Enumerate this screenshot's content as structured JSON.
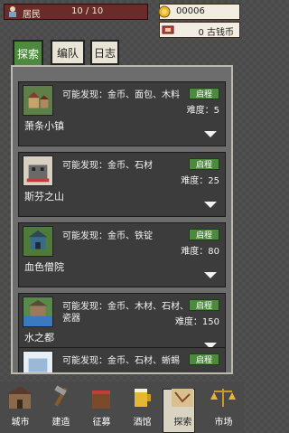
{
  "header": {
    "resident_label": "居民",
    "resident_count": "10 / 10",
    "gold": "00006",
    "coins": "0 古钱币"
  },
  "tabs": [
    {
      "label": "探索",
      "active": true
    },
    {
      "label": "编队",
      "active": false
    },
    {
      "label": "日志",
      "active": false
    }
  ],
  "locations": [
    {
      "name": "萧条小镇",
      "finds": "可能发现：金币、面包、木料",
      "go": "启程",
      "difficulty": "难度：5",
      "icon": "town-icon"
    },
    {
      "name": "斯芬之山",
      "finds": "可能发现：金币、石材",
      "go": "启程",
      "difficulty": "难度：25",
      "icon": "mountain-icon"
    },
    {
      "name": "血色僧院",
      "finds": "可能发现：金币、铁锭",
      "go": "启程",
      "difficulty": "难度：80",
      "icon": "monastery-icon"
    },
    {
      "name": "水之都",
      "finds": "可能发现：金币、木材、石材、瓷器",
      "go": "启程",
      "difficulty": "难度：150",
      "icon": "water-city-icon"
    },
    {
      "name": "",
      "finds": "可能发现：金币、石材、蜥蜴",
      "go": "启程",
      "difficulty": "",
      "icon": "ice-icon"
    }
  ],
  "nav": [
    {
      "label": "城市",
      "icon": "city-icon"
    },
    {
      "label": "建造",
      "icon": "build-icon"
    },
    {
      "label": "征募",
      "icon": "recruit-icon"
    },
    {
      "label": "酒馆",
      "icon": "tavern-icon"
    },
    {
      "label": "探索",
      "icon": "explore-icon",
      "active": true
    },
    {
      "label": "市场",
      "icon": "market-icon"
    }
  ],
  "colors": {
    "accent_green": "#4d8a3e",
    "resident_bg": "#6a2b2b",
    "panel": "#6d6d6d"
  }
}
